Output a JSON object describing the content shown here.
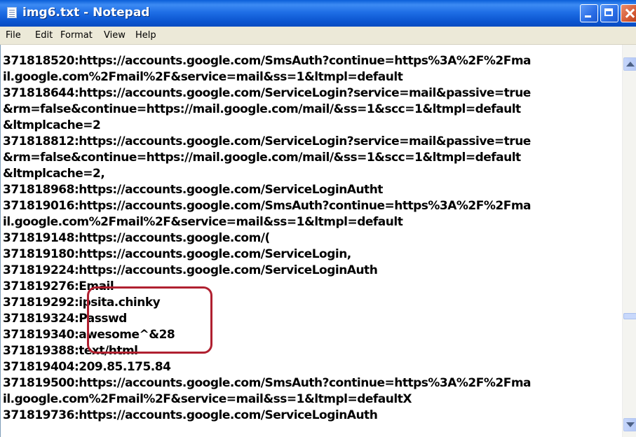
{
  "window": {
    "title": "img6.txt - Notepad",
    "icon": "notepad-document-icon",
    "controls": {
      "minimize": "minimize-icon",
      "maximize": "maximize-icon",
      "close": "close-icon"
    }
  },
  "menu": {
    "items": [
      {
        "label": "File"
      },
      {
        "label": "Edit"
      },
      {
        "label": "Format"
      },
      {
        "label": "View"
      },
      {
        "label": "Help"
      }
    ]
  },
  "document": {
    "lines": [
      "371818520:https://accounts.google.com/SmsAuth?continue=https%3A%2F%2Fma",
      "il.google.com%2Fmail%2F&service=mail&ss=1&ltmpl=default",
      "371818644:https://accounts.google.com/ServiceLogin?service=mail&passive=true",
      "&rm=false&continue=https://mail.google.com/mail/&ss=1&scc=1&ltmpl=default",
      "&ltmplcache=2",
      "371818812:https://accounts.google.com/ServiceLogin?service=mail&passive=true",
      "&rm=false&continue=https://mail.google.com/mail/&ss=1&scc=1&ltmpl=default",
      "&ltmplcache=2,",
      "371818968:https://accounts.google.com/ServiceLoginAutht",
      "371819016:https://accounts.google.com/SmsAuth?continue=https%3A%2F%2Fma",
      "il.google.com%2Fmail%2F&service=mail&ss=1&ltmpl=default",
      "371819148:https://accounts.google.com/(",
      "371819180:https://accounts.google.com/ServiceLogin,",
      "371819224:https://accounts.google.com/ServiceLoginAuth",
      "371819276:Email",
      "371819292:ipsita.chinky",
      "371819324:Passwd",
      "371819340:awesome^&28",
      "371819388:text/html",
      "371819404:209.85.175.84",
      "371819500:https://accounts.google.com/SmsAuth?continue=https%3A%2F%2Fma",
      "il.google.com%2Fmail%2F&service=mail&ss=1&ltmpl=defaultX",
      "371819736:https://accounts.google.com/ServiceLoginAuth"
    ]
  },
  "annotation": {
    "color": "#b02030"
  },
  "colors": {
    "titlebar": "#0a5fd8",
    "menubar": "#ece9d8",
    "scrollbar_button": "#c6d6fb"
  }
}
